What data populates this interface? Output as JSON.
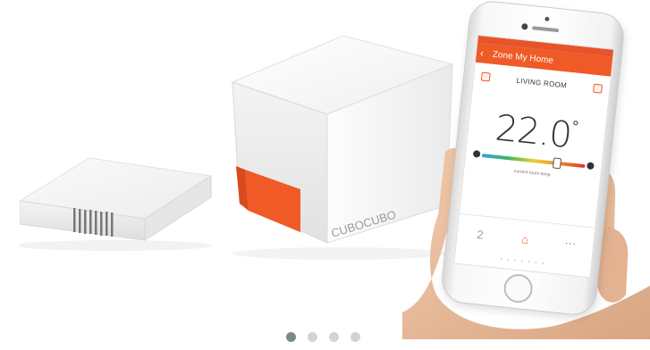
{
  "product_scene": {
    "cube_logo": "CUBOCUBO",
    "phone": {
      "app_bar_title": "Zone My Home",
      "zone_name": "LIVING ROOM",
      "temperature": "22.0",
      "temperature_unit": "°",
      "slider_level": 0.72,
      "slider_caption": "current room temp",
      "bottom_tabs": [
        "2",
        "",
        ""
      ],
      "page_indicator": "• • • • • • •"
    }
  },
  "carousel": {
    "slide_count": 4,
    "active_index": 0
  },
  "colors": {
    "accent_orange": "#ef5a26",
    "dot_active": "#7a8a8f",
    "dot_inactive": "#cfd5d7"
  }
}
